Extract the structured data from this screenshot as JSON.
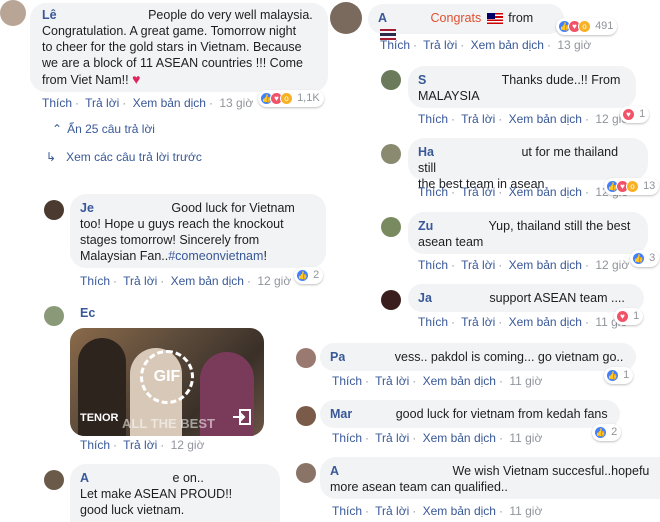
{
  "comments": [
    {
      "name": "Lê",
      "text_lines": [
        "People do very well malaysia.",
        "Congratulation. A great game. Tomorrow night",
        "to cheer for the gold stars in Vietnam. Because",
        "we are a block of 11 ASEAN countries !!! Come",
        "from Viet Nam!!"
      ],
      "actions": {
        "like": "Thích",
        "reply": "Trả lời",
        "translate": "Xem bản dịch",
        "time": "13 giờ"
      },
      "reaction_count": "1,1K"
    },
    {
      "name": "A",
      "text_prefix": "Congrats",
      "text_mid": "from",
      "actions": {
        "like": "Thích",
        "reply": "Trả lời",
        "translate": "Xem bản dịch",
        "time": "13 giờ"
      },
      "reaction_count": "491"
    }
  ],
  "collapse": {
    "hide_replies": "Ẩn 25 câu trả lời",
    "prev_replies": "Xem các câu trả lời trước"
  },
  "left_replies": [
    {
      "name": "Je",
      "text_lines": [
        "Good luck for Vietnam",
        "too! Hope u guys reach the knockout",
        "stages tomorrow! Sincerely from",
        "Malaysian Fan.."
      ],
      "hashtag": "#comeonvietnam",
      "hashtag_suffix": "!",
      "actions": {
        "like": "Thích",
        "reply": "Trả lời",
        "translate": "Xem bản dịch",
        "time": "12 giờ"
      },
      "reaction_count": "2"
    },
    {
      "name": "Ec",
      "gif": {
        "label": "GIF",
        "brand": "TENOR",
        "caption": "ALL THE BEST"
      },
      "actions": {
        "like": "Thích",
        "reply": "Trả lời",
        "time": "12 giờ"
      }
    },
    {
      "name": "A",
      "text_lines": [
        "e on..",
        "Let make ASEAN PROUD!!",
        "good luck vietnam."
      ]
    }
  ],
  "right_replies": [
    {
      "name": "S",
      "text_lines": [
        "Thanks dude..!! From",
        "MALAYSIA"
      ],
      "actions": {
        "like": "Thích",
        "reply": "Trả lời",
        "translate": "Xem bản dịch",
        "time": "12 giờ"
      },
      "reaction_count": "1"
    },
    {
      "name": "Ha",
      "text_lines": [
        "ut for me thailand still",
        "the best team in asean"
      ],
      "actions": {
        "like": "Thích",
        "reply": "Trả lời",
        "translate": "Xem bản dịch",
        "time": "12 giờ"
      },
      "reaction_count": "13"
    },
    {
      "name": "Zu",
      "text_lines": [
        "Yup, thailand still the best",
        "asean team"
      ],
      "actions": {
        "like": "Thích",
        "reply": "Trả lời",
        "translate": "Xem bản dịch",
        "time": "12 giờ"
      },
      "reaction_count": "3"
    },
    {
      "name": "Ja",
      "text_lines": [
        "support ASEAN team ...."
      ],
      "actions": {
        "like": "Thích",
        "reply": "Trả lời",
        "translate": "Xem bản dịch",
        "time": "11 giờ"
      },
      "reaction_count": "1"
    },
    {
      "name": "Pa",
      "text_lines": [
        "vess.. pakdol is coming... go vietnam go.."
      ],
      "actions": {
        "like": "Thích",
        "reply": "Trả lời",
        "translate": "Xem bản dịch",
        "time": "11 giờ"
      },
      "reaction_count": "1"
    },
    {
      "name": "Mar",
      "text_lines": [
        "good luck for vietnam from kedah fans"
      ],
      "actions": {
        "like": "Thích",
        "reply": "Trả lời",
        "translate": "Xem bản dịch",
        "time": "11 giờ"
      },
      "reaction_count": "2"
    },
    {
      "name": "A",
      "text_lines": [
        "We wish Vietnam succesful..hopefu",
        "more asean team can qualified.."
      ],
      "actions": {
        "like": "Thích",
        "reply": "Trả lời",
        "translate": "Xem bản dịch",
        "time": "11 giờ"
      }
    }
  ],
  "colors": {
    "link": "#385898",
    "bubble": "#f2f3f5",
    "meta": "#90949c",
    "like": "#4080ff",
    "love": "#f25268",
    "haha": "#f7b125"
  }
}
